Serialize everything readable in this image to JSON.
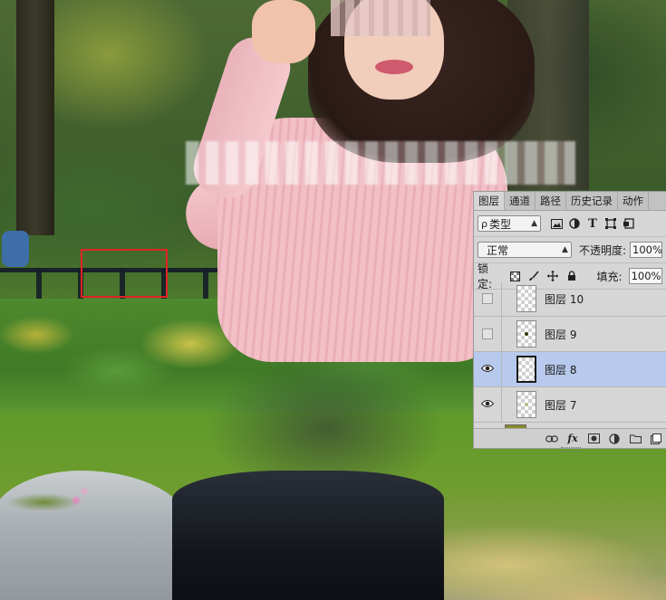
{
  "layers_panel": {
    "tabs": [
      {
        "label": "图层",
        "active": true
      },
      {
        "label": "通道",
        "active": false
      },
      {
        "label": "路径",
        "active": false
      },
      {
        "label": "历史记录",
        "active": false
      },
      {
        "label": "动作",
        "active": false
      }
    ],
    "filter": {
      "label": "类型",
      "search_icon": "ρ"
    },
    "filter_icons": [
      "image-filter-icon",
      "adjustment-filter-icon",
      "text-filter-icon",
      "shape-filter-icon",
      "smart-object-filter-icon"
    ],
    "blend_mode": "正常",
    "opacity_label": "不透明度:",
    "opacity_value": "100%",
    "lock_label": "锁定:",
    "fill_label": "填充:",
    "fill_value": "100%",
    "layers": [
      {
        "name": "图层 10",
        "visible": false,
        "selected": false
      },
      {
        "name": "图层 9",
        "visible": false,
        "selected": false
      },
      {
        "name": "图层 8",
        "visible": true,
        "selected": true
      },
      {
        "name": "图层 7",
        "visible": true,
        "selected": false
      }
    ],
    "bottom_icons": [
      "link-icon",
      "fx-icon",
      "mask-icon",
      "adjustment-icon",
      "folder-icon",
      "new-layer-icon"
    ],
    "fx_label": "fx"
  },
  "colors": {
    "selection_box": "#e02424",
    "selected_layer": "#b7c9ec",
    "panel_bg": "#d6d6d6"
  }
}
